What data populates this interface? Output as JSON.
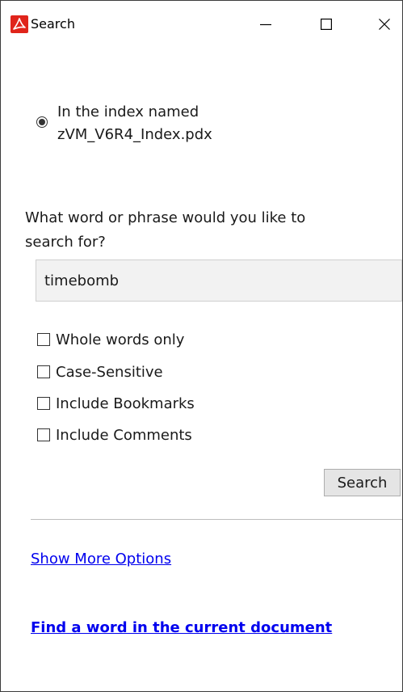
{
  "window": {
    "title": "Search",
    "icon": "adobe-acrobat-icon",
    "controls": [
      "minimize-icon",
      "maximize-icon",
      "close-icon"
    ],
    "accent_color": "#e0241b"
  },
  "index_option": {
    "label_line1": "In the index named",
    "label_line2": "zVM_V6R4_Index.pdx",
    "selected": true
  },
  "search": {
    "question_line1": "What word or phrase would you like to",
    "question_line2": "search for?",
    "value": "timebomb"
  },
  "options": [
    {
      "label": "Whole words only",
      "checked": false
    },
    {
      "label": "Case-Sensitive",
      "checked": false
    },
    {
      "label": "Include Bookmarks",
      "checked": false
    },
    {
      "label": "Include Comments",
      "checked": false
    }
  ],
  "actions": {
    "search_label": "Search",
    "more_options_label": "Show More Options",
    "find_in_document_label": "Find a word in the current document"
  },
  "colors": {
    "link": "#0000ee",
    "input_bg": "#f2f2f2",
    "button_bg": "#e5e5e5"
  }
}
